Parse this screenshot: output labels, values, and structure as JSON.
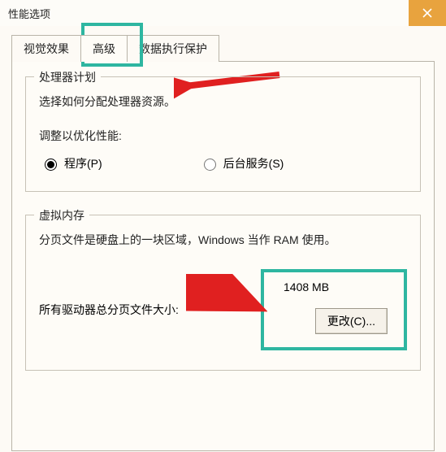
{
  "window": {
    "title": "性能选项"
  },
  "tabs": {
    "visual_effects": "视觉效果",
    "advanced": "高级",
    "dep": "数据执行保护",
    "active_index": 1
  },
  "processor": {
    "group_title": "处理器计划",
    "desc": "选择如何分配处理器资源。",
    "adjust_label": "调整以优化性能:",
    "option_programs": "程序(P)",
    "option_background": "后台服务(S)",
    "selected": "programs"
  },
  "virtual_memory": {
    "group_title": "虚拟内存",
    "desc": "分页文件是硬盘上的一块区域，Windows 当作 RAM 使用。",
    "total_label": "所有驱动器总分页文件大小:",
    "total_value": "1408 MB",
    "change_button": "更改(C)..."
  },
  "annotations": {
    "highlight_color": "#2eb6a1",
    "arrow_color": "#e02020"
  }
}
